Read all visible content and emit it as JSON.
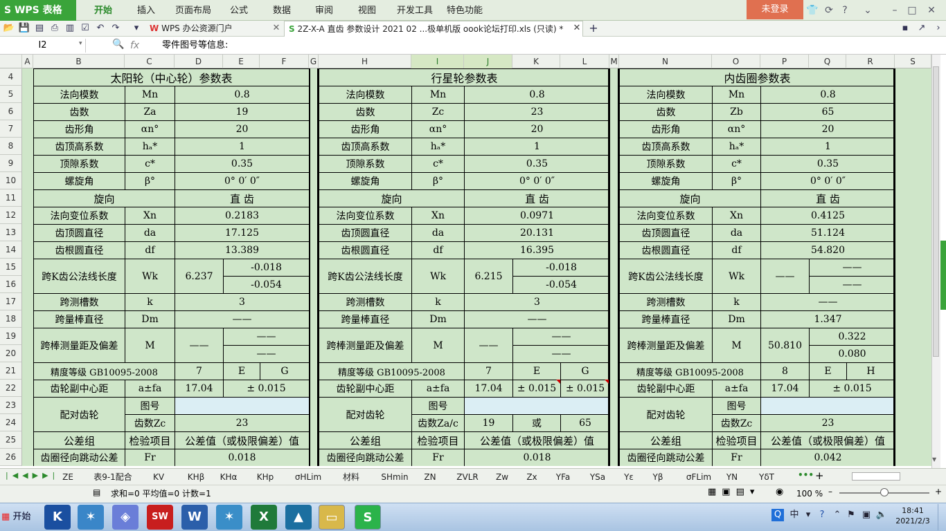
{
  "app": {
    "logo": "S WPS 表格"
  },
  "menu": {
    "items": [
      "开始",
      "插入",
      "页面布局",
      "公式",
      "数据",
      "审阅",
      "视图",
      "开发工具",
      "特色功能"
    ],
    "login": "未登录"
  },
  "tabs": {
    "portal": "WPS 办公资源门户",
    "doc": "2Z-X-A 直齿  参数设计 2021 02 ...极单机版 oook论坛打印.xls (只读) *"
  },
  "formula_bar": {
    "cell_ref": "I2",
    "fx": "fx",
    "content": "零件图号等信息:"
  },
  "columns": [
    "A",
    "B",
    "C",
    "D",
    "E",
    "F",
    "G",
    "H",
    "I",
    "J",
    "K",
    "L",
    "M",
    "N",
    "O",
    "P",
    "Q",
    "R",
    "S"
  ],
  "rows": [
    "4",
    "5",
    "6",
    "7",
    "8",
    "9",
    "10",
    "11",
    "12",
    "13",
    "14",
    "15",
    "16",
    "17",
    "18",
    "19",
    "20",
    "21",
    "22",
    "23",
    "24",
    "25",
    "26"
  ],
  "sun": {
    "title": "太阳轮（中心轮）参数表",
    "rows": [
      [
        "法向模数",
        "Mn",
        "0.8"
      ],
      [
        "齿数",
        "Za",
        "19"
      ],
      [
        "齿形角",
        "αn°",
        "20"
      ],
      [
        "齿顶高系数",
        "hₐ*",
        "1"
      ],
      [
        "顶隙系数",
        "c*",
        "0.35"
      ],
      [
        "螺旋角",
        "β°",
        "0° 0′ 0″"
      ]
    ],
    "dir": [
      "旋向",
      "直 齿"
    ],
    "rows2": [
      [
        "法向变位系数",
        "Xn",
        "0.2183"
      ],
      [
        "齿顶圆直径",
        "da",
        "17.125"
      ],
      [
        "齿根圆直径",
        "df",
        "13.389"
      ]
    ],
    "wk": {
      "label": "跨K齿公法线长度",
      "sym": "Wk",
      "val": "6.237",
      "up": "-0.018",
      "low": "-0.054"
    },
    "k": [
      "跨测槽数",
      "k",
      "3"
    ],
    "dm": [
      "跨量棒直径",
      "Dm",
      "——"
    ],
    "m": {
      "label": "跨棒测量距及偏差",
      "sym": "M",
      "val": "——",
      "up": "——",
      "low": "——"
    },
    "grade": [
      "精度等级 GB10095-2008",
      "7",
      "E",
      "G"
    ],
    "center": [
      "齿轮副中心距",
      "a±fa",
      "17.04",
      "± 0.015"
    ],
    "mate": {
      "label": "配对齿轮",
      "fig": "图号",
      "figval": "",
      "teeth": "齿数Zc",
      "teethval": "23"
    },
    "tol": [
      "公差组",
      "检验项目",
      "公差值（或极限偏差）值"
    ],
    "fr": [
      "齿圈径向跳动公差",
      "Fr",
      "0.018"
    ]
  },
  "planet": {
    "title": "行星轮参数表",
    "rows": [
      [
        "法向模数",
        "Mn",
        "0.8"
      ],
      [
        "齿数",
        "Zc",
        "23"
      ],
      [
        "齿形角",
        "αn°",
        "20"
      ],
      [
        "齿顶高系数",
        "hₐ*",
        "1"
      ],
      [
        "顶隙系数",
        "c*",
        "0.35"
      ],
      [
        "螺旋角",
        "β°",
        "0° 0′ 0″"
      ]
    ],
    "dir": [
      "旋向",
      "直 齿"
    ],
    "rows2": [
      [
        "法向变位系数",
        "Xn",
        "0.0971"
      ],
      [
        "齿顶圆直径",
        "da",
        "20.131"
      ],
      [
        "齿根圆直径",
        "df",
        "16.395"
      ]
    ],
    "wk": {
      "label": "跨K齿公法线长度",
      "sym": "Wk",
      "val": "6.215",
      "up": "-0.018",
      "low": "-0.054"
    },
    "k": [
      "跨测槽数",
      "k",
      "3"
    ],
    "dm": [
      "跨量棒直径",
      "Dm",
      "——"
    ],
    "m": {
      "label": "跨棒测量距及偏差",
      "sym": "M",
      "val": "——",
      "up": "——",
      "low": "——"
    },
    "grade": [
      "精度等级 GB10095-2008",
      "7",
      "E",
      "G"
    ],
    "center": [
      "齿轮副中心距",
      "a±fa",
      "17.04",
      "± 0.015",
      "± 0.015"
    ],
    "mate": {
      "label": "配对齿轮",
      "fig": "图号",
      "figval": "",
      "teeth": "齿数Za/c",
      "t1": "19",
      "or": "或",
      "t2": "65"
    },
    "tol": [
      "公差组",
      "检验项目",
      "公差值（或极限偏差）值"
    ],
    "fr": [
      "齿圈径向跳动公差",
      "Fr",
      "0.018"
    ]
  },
  "ring": {
    "title": "内齿圈参数表",
    "rows": [
      [
        "法向模数",
        "Mn",
        "0.8"
      ],
      [
        "齿数",
        "Zb",
        "65"
      ],
      [
        "齿形角",
        "αn°",
        "20"
      ],
      [
        "齿顶高系数",
        "hₐ*",
        "1"
      ],
      [
        "顶隙系数",
        "c*",
        "0.35"
      ],
      [
        "螺旋角",
        "β°",
        "0° 0′ 0″"
      ]
    ],
    "dir": [
      "旋向",
      "直 齿"
    ],
    "rows2": [
      [
        "法向变位系数",
        "Xn",
        "0.4125"
      ],
      [
        "齿顶圆直径",
        "da",
        "51.124"
      ],
      [
        "齿根圆直径",
        "df",
        "54.820"
      ]
    ],
    "wk": {
      "label": "跨K齿公法线长度",
      "sym": "Wk",
      "val": "——",
      "up": "——",
      "low": "——"
    },
    "k": [
      "跨测槽数",
      "k",
      "——"
    ],
    "dm": [
      "跨量棒直径",
      "Dm",
      "1.347"
    ],
    "m": {
      "label": "跨棒测量距及偏差",
      "sym": "M",
      "val": "50.810",
      "up": "0.322",
      "low": "0.080"
    },
    "grade": [
      "精度等级 GB10095-2008",
      "8",
      "E",
      "H"
    ],
    "center": [
      "齿轮副中心距",
      "a±fa",
      "17.04",
      "± 0.015"
    ],
    "mate": {
      "label": "配对齿轮",
      "fig": "图号",
      "figval": "",
      "teeth": "齿数Zc",
      "teethval": "23"
    },
    "tol": [
      "公差组",
      "检验项目",
      "公差值（或极限偏差）值"
    ],
    "fr": [
      "齿圈径向跳动公差",
      "Fr",
      "0.042"
    ]
  },
  "sheets": [
    "ZE",
    "表9-1配合",
    "KV",
    "KHβ",
    "KHα",
    "KHp",
    "σHLim",
    "材料",
    "SHmin",
    "ZN",
    "ZVLR",
    "Zw",
    "Zx",
    "YFa",
    "YSa",
    "Yε",
    "Yβ",
    "σFLim",
    "YN",
    "YδT"
  ],
  "status": {
    "text": "求和=0  平均值=0  计数=1",
    "zoom": "100 %"
  },
  "taskbar": {
    "start": "开始",
    "time": "18:41",
    "date": "2021/2/3"
  }
}
